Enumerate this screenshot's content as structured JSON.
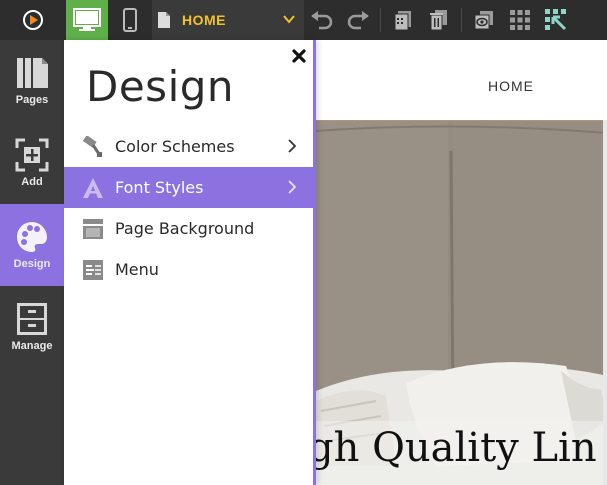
{
  "toolbar": {
    "page_selector": {
      "label": "HOME"
    },
    "icons": {
      "logo": "brand-logo-icon",
      "desktop": "desktop-monitor-icon",
      "mobile": "mobile-phone-icon",
      "page": "page-doc-icon",
      "undo": "undo-icon",
      "redo": "redo-icon",
      "pages_stack": "pages-stack-icon",
      "trash": "trash-icon",
      "preview": "preview-eye-icon",
      "apps": "apps-grid-icon",
      "exit": "exit-editor-icon"
    },
    "colors": {
      "bar": "#2d2d2d",
      "active_device": "#5fb04a",
      "page_label": "#f2c12e"
    }
  },
  "sidebar": {
    "items": [
      {
        "label": "Pages",
        "icon": "pages-icon"
      },
      {
        "label": "Add",
        "icon": "add-icon"
      },
      {
        "label": "Design",
        "icon": "palette-icon",
        "active": true
      },
      {
        "label": "Manage",
        "icon": "cabinet-icon"
      }
    ],
    "colors": {
      "bg": "#3a3a3a",
      "active": "#8c72e1"
    }
  },
  "design_panel": {
    "title": "Design",
    "close_icon": "close-icon",
    "items": [
      {
        "label": "Color Schemes",
        "icon": "paint-roller-icon",
        "has_arrow": true
      },
      {
        "label": "Font Styles",
        "icon": "font-a-icon",
        "has_arrow": true,
        "active": true
      },
      {
        "label": "Page Background",
        "icon": "background-icon",
        "has_arrow": false
      },
      {
        "label": "Menu",
        "icon": "menu-icon",
        "has_arrow": false
      }
    ]
  },
  "canvas": {
    "nav": {
      "home": "HOME"
    },
    "hero": {
      "text": "gh Quality Lin"
    }
  }
}
